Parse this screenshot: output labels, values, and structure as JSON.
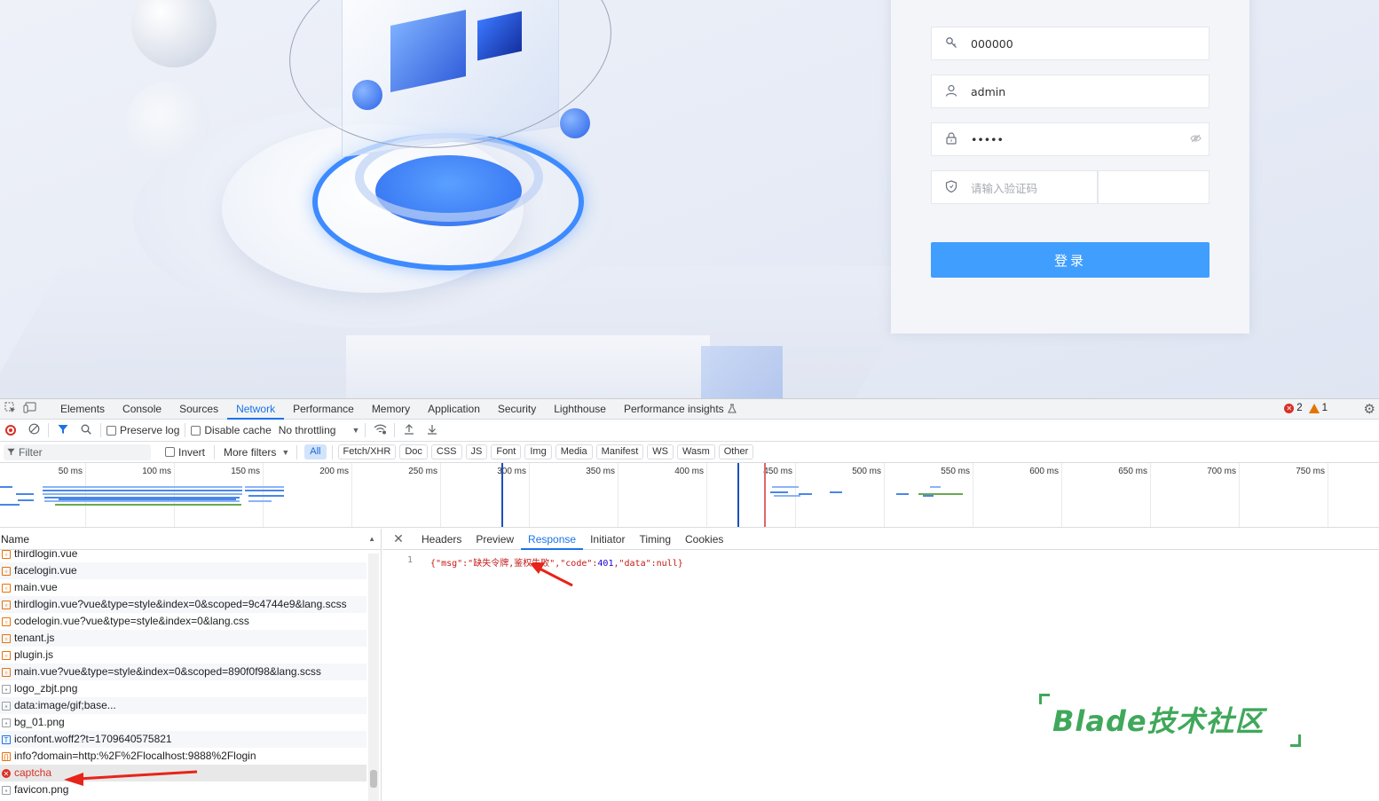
{
  "login": {
    "tenant_value": "000000",
    "username_value": "admin",
    "password_value": "•••••",
    "captcha_placeholder": "请输入验证码",
    "login_button": "登录"
  },
  "devtools": {
    "tabs": [
      "Elements",
      "Console",
      "Sources",
      "Network",
      "Performance",
      "Memory",
      "Application",
      "Security",
      "Lighthouse",
      "Performance insights"
    ],
    "active_tab": "Network",
    "error_count": "2",
    "warning_count": "1",
    "toolbar": {
      "preserve_log": "Preserve log",
      "disable_cache": "Disable cache",
      "throttling": "No throttling"
    },
    "filterbar": {
      "filter_placeholder": "Filter",
      "invert": "Invert",
      "more_filters": "More filters",
      "types": [
        "All",
        "Fetch/XHR",
        "Doc",
        "CSS",
        "JS",
        "Font",
        "Img",
        "Media",
        "Manifest",
        "WS",
        "Wasm",
        "Other"
      ]
    },
    "timeline_ticks": [
      "50 ms",
      "100 ms",
      "150 ms",
      "200 ms",
      "250 ms",
      "300 ms",
      "350 ms",
      "400 ms",
      "450 ms",
      "500 ms",
      "550 ms",
      "600 ms",
      "650 ms",
      "700 ms",
      "750 ms"
    ],
    "requests": {
      "header": "Name",
      "items": [
        {
          "name": "thirdlogin.vue",
          "icon": "file-icon"
        },
        {
          "name": "facelogin.vue",
          "icon": "file-icon"
        },
        {
          "name": "main.vue",
          "icon": "file-icon"
        },
        {
          "name": "thirdlogin.vue?vue&type=style&index=0&scoped=9c4744e9&lang.scss",
          "icon": "file-icon"
        },
        {
          "name": "codelogin.vue?vue&type=style&index=0&lang.css",
          "icon": "file-icon"
        },
        {
          "name": "tenant.js",
          "icon": "file-icon"
        },
        {
          "name": "plugin.js",
          "icon": "file-icon"
        },
        {
          "name": "main.vue?vue&type=style&index=0&scoped=890f0f98&lang.scss",
          "icon": "file-icon"
        },
        {
          "name": "logo_zbjt.png",
          "icon": "image-icon"
        },
        {
          "name": "data:image/gif;base...",
          "icon": "image-icon"
        },
        {
          "name": "bg_01.png",
          "icon": "image-icon"
        },
        {
          "name": "iconfont.woff2?t=1709640575821",
          "icon": "font-icon"
        },
        {
          "name": "info?domain=http:%2F%2Flocalhost:9888%2Flogin",
          "icon": "json-icon"
        },
        {
          "name": "captcha",
          "icon": "error-icon",
          "error": true
        },
        {
          "name": "favicon.png",
          "icon": "image-icon"
        }
      ]
    },
    "detail": {
      "tabs": [
        "Headers",
        "Preview",
        "Response",
        "Initiator",
        "Timing",
        "Cookies"
      ],
      "active_tab": "Response",
      "line_number": "1",
      "response_open": "{\"msg\":\"缺失令牌,鉴权失败\",\"code\":",
      "response_code": "401",
      "response_close": ",\"data\":null}"
    }
  },
  "watermark": "Blade技术社区",
  "colors": {
    "accent": "#1a73e8",
    "login_button": "#409eff",
    "error": "#d93025",
    "watermark": "#3fa85a"
  }
}
